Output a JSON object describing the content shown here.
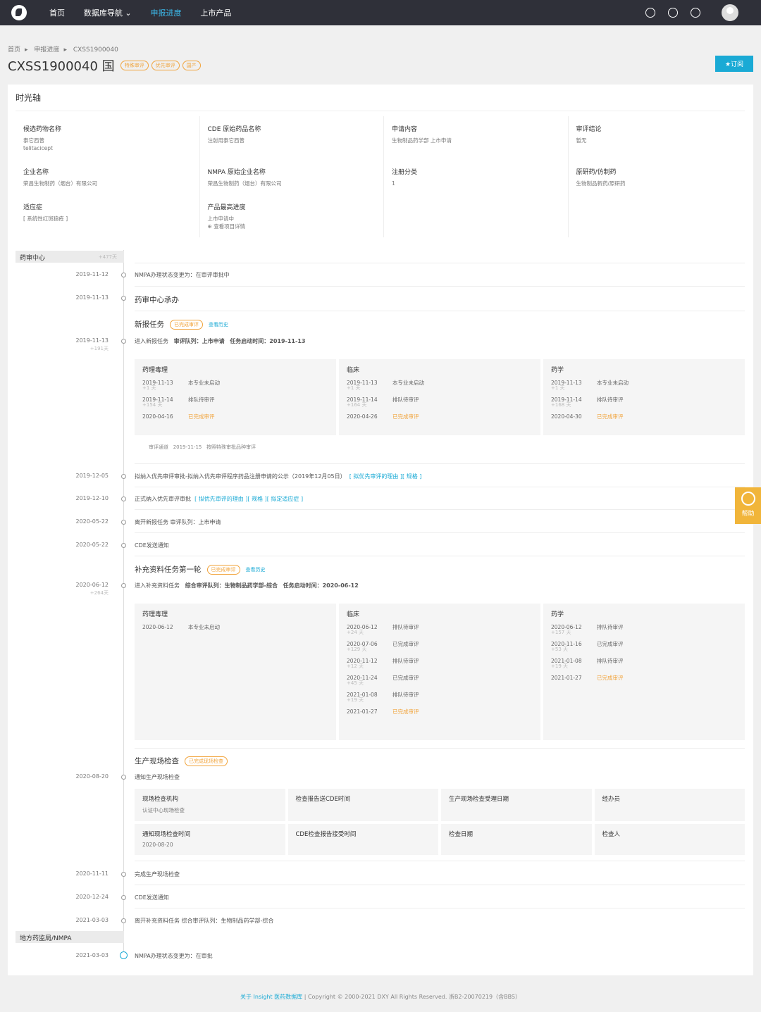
{
  "nav": {
    "home": "首页",
    "db": "数据库导航",
    "db_arrow": "⌄",
    "progress": "申报进度",
    "products": "上市产品"
  },
  "breadcrumb": [
    "首页",
    "申报进度",
    "CXSS1900040"
  ],
  "crumb_sep": "▸",
  "title": "CXSS1900040 国",
  "tags": [
    "特殊审评",
    "优先审评",
    "国产"
  ],
  "subscribe": "★订阅",
  "card_title": "时光轴",
  "info": [
    {
      "label": "候选药物名称",
      "value": "泰它西普",
      "value2": "telitacicept"
    },
    {
      "label": "CDE 原始药品名称",
      "value": "注射用泰它西普"
    },
    {
      "label": "申请内容",
      "value": "生物制品药学部 上市申请"
    },
    {
      "label": "审评结论",
      "value": "暂无"
    },
    {
      "label": "企业名称",
      "value": "荣昌生物制药（烟台）有限公司"
    },
    {
      "label": "NMPA 原始企业名称",
      "value": "荣昌生物制药（烟台）有限公司"
    },
    {
      "label": "注册分类",
      "value": "1"
    },
    {
      "label": "原研药/仿制药",
      "value": "生物制品新药/原研药"
    },
    {
      "label": "适应症",
      "value": "[ 系统性红斑狼疮 ]"
    },
    {
      "label": "产品最高进度",
      "value": "上市申请中",
      "value2": "查看项目详情"
    }
  ],
  "sec1": {
    "label": "药审中心",
    "days": "+477天"
  },
  "sec2": {
    "label": "地方药监局/NMPA"
  },
  "events": {
    "e1": {
      "date": "2019-11-12",
      "text": "NMPA办理状态变更为：在审评审批中"
    },
    "e2": {
      "date": "2019-11-13",
      "text": "药审中心承办"
    },
    "task1": {
      "title": "新报任务",
      "tag": "已完成审评",
      "hist": "查看历史"
    },
    "e3": {
      "date": "2019-11-13",
      "sub": "+191天",
      "text": "进入新报任务",
      "queue": "审评队列：上市申请",
      "start": "任务启动时间：2019-11-13"
    },
    "channel": {
      "label": "审评通道",
      "date": "2019-11-15",
      "text": "按照特殊审批品种审评"
    },
    "e4": {
      "date": "2019-12-05",
      "text": "拟纳入优先审评审批-拟纳入优先审评程序药品注册申请的公示（2019年12月05日）",
      "links": "[ 拟优先审评的理由 ][ 规格 ]"
    },
    "e5": {
      "date": "2019-12-10",
      "text": "正式纳入优先审评审批",
      "links": "[ 拟优先审评的理由 ][ 规格 ][ 拟定适应症 ]"
    },
    "e6": {
      "date": "2020-05-22",
      "text": "离开新报任务 审评队列：上市申请"
    },
    "e7": {
      "date": "2020-05-22",
      "text": "CDE发送通知"
    },
    "task2": {
      "title": "补充资料任务第一轮",
      "tag": "已完成审评",
      "hist": "查看历史"
    },
    "e8": {
      "date": "2020-06-12",
      "sub": "+264天",
      "text": "进入补充资料任务",
      "queue": "综合审评队列：生物制品药学部-综合",
      "start": "任务启动时间：2020-06-12"
    },
    "task3": {
      "title": "生产现场检查",
      "tag": "已完成现场检查"
    },
    "e9": {
      "date": "2020-08-20",
      "text": "通知生产现场检查"
    },
    "e10": {
      "date": "2020-11-11",
      "text": "完成生产现场检查"
    },
    "e11": {
      "date": "2020-12-24",
      "text": "CDE发送通知"
    },
    "e12": {
      "date": "2021-03-03",
      "text": "离开补充资料任务 综合审评队列：生物制品药学部-综合"
    },
    "e13": {
      "date": "2021-03-03",
      "text": "NMPA办理状态变更为：在审批"
    }
  },
  "panel1": [
    {
      "title": "药理毒理",
      "rows": [
        [
          "2019-11-13",
          "本专业未启动",
          "+1 天"
        ],
        [
          "2019-11-14",
          "排队待审评",
          "+154 天"
        ],
        [
          "2020-04-16",
          "已完成审评",
          ""
        ]
      ]
    },
    {
      "title": "临床",
      "rows": [
        [
          "2019-11-13",
          "本专业未启动",
          "+1 天"
        ],
        [
          "2019-11-14",
          "排队待审评",
          "+164 天"
        ],
        [
          "2020-04-26",
          "已完成审评",
          ""
        ]
      ]
    },
    {
      "title": "药学",
      "rows": [
        [
          "2019-11-13",
          "本专业未启动",
          "+1 天"
        ],
        [
          "2019-11-14",
          "排队待审评",
          "+168 天"
        ],
        [
          "2020-04-30",
          "已完成审评",
          ""
        ]
      ]
    }
  ],
  "panel2": [
    {
      "title": "药理毒理",
      "rows": [
        [
          "2020-06-12",
          "本专业未启动",
          ""
        ]
      ]
    },
    {
      "title": "临床",
      "rows": [
        [
          "2020-06-12",
          "排队待审评",
          "+24 天"
        ],
        [
          "2020-07-06",
          "已完成审评",
          "+129 天"
        ],
        [
          "2020-11-12",
          "排队待审评",
          "+12 天"
        ],
        [
          "2020-11-24",
          "已完成审评",
          "+45 天"
        ],
        [
          "2021-01-08",
          "排队待审评",
          "+19 天"
        ],
        [
          "2021-01-27",
          "已完成审评",
          ""
        ]
      ]
    },
    {
      "title": "药学",
      "rows": [
        [
          "2020-06-12",
          "排队待审评",
          "+157 天"
        ],
        [
          "2020-11-16",
          "已完成审评",
          "+53 天"
        ],
        [
          "2021-01-08",
          "排队待审评",
          "+19 天"
        ],
        [
          "2021-01-27",
          "已完成审评",
          ""
        ]
      ]
    }
  ],
  "inspection": [
    {
      "label": "现场检查机构",
      "value": "认证中心现场检查"
    },
    {
      "label": "检查报告送CDE时间",
      "value": ""
    },
    {
      "label": "生产现场检查受理日期",
      "value": ""
    },
    {
      "label": "经办员",
      "value": ""
    },
    {
      "label": "通知现场检查时间",
      "value": "2020-08-20"
    },
    {
      "label": "CDE检查报告接受时间",
      "value": ""
    },
    {
      "label": "检查日期",
      "value": ""
    },
    {
      "label": "检查人",
      "value": ""
    }
  ],
  "help": "帮助",
  "footer": {
    "link": "关于 Insight 医药数据库",
    "text": " | Copyright © 2000-2021 DXY All Rights Reserved. 浙B2-20070219（含BBS）"
  }
}
